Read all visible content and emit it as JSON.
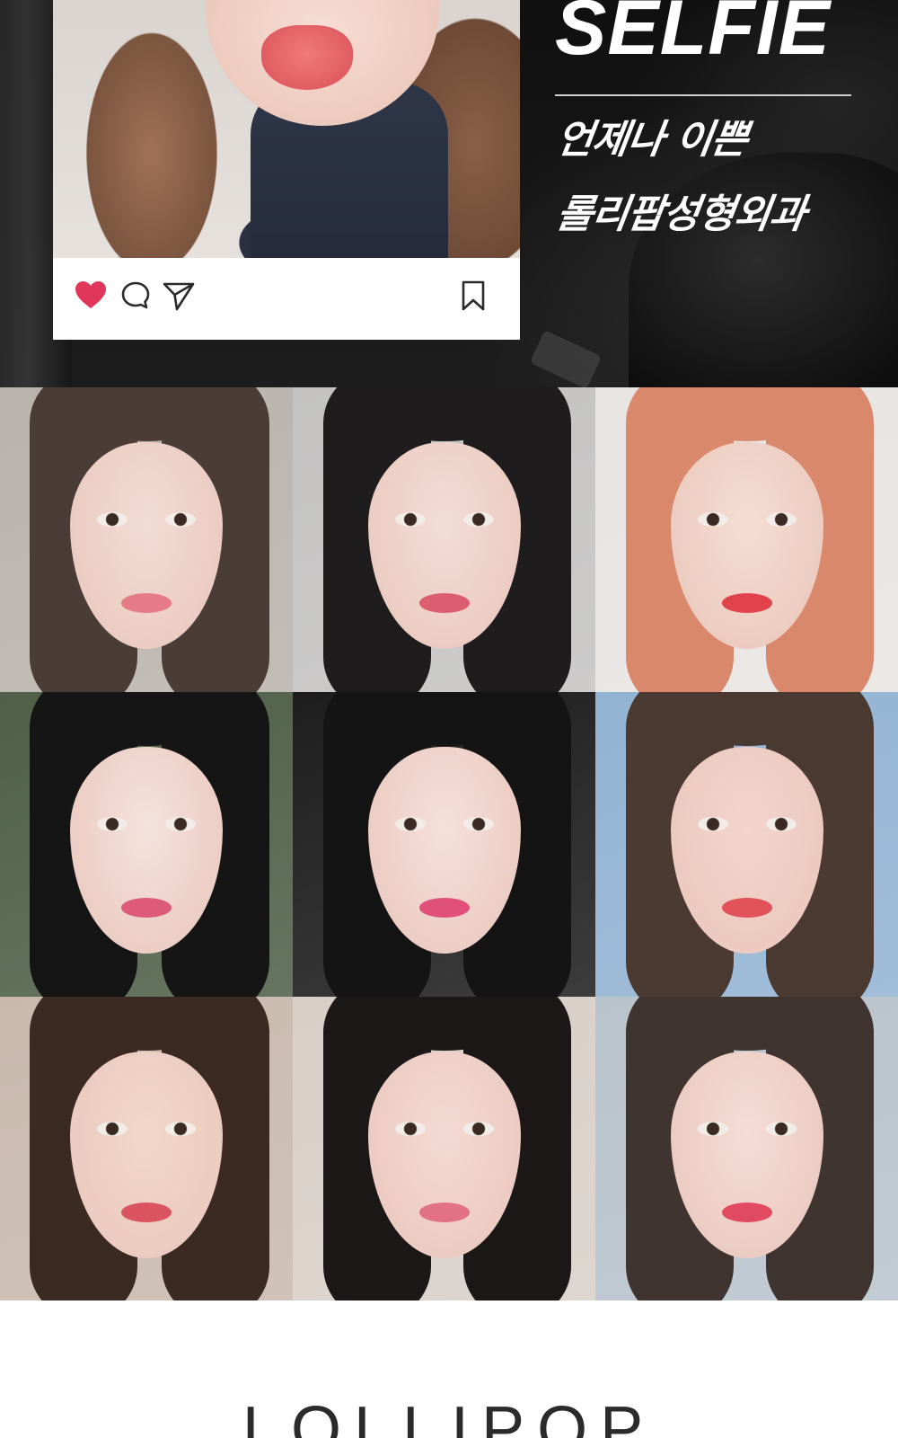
{
  "hero": {
    "title": "SELFIE",
    "tagline_line1": "언제나 이쁜",
    "tagline_line2": "롤리팝성형외과",
    "post_actions": {
      "like_icon": "heart-icon",
      "comment_icon": "comment-icon",
      "share_icon": "send-icon",
      "save_icon": "bookmark-icon"
    },
    "colors": {
      "like": "#e0365a",
      "lips": "#e86468",
      "background": "#141414",
      "text": "#ffffff"
    }
  },
  "grid": {
    "tiles": [
      {
        "label": "selfie-1",
        "bg": "#b9b3ad",
        "skin": "#f2dcd4",
        "hair": "#4a3d38",
        "lip": "#e47b86"
      },
      {
        "label": "selfie-2",
        "bg": "#c4c3c2",
        "skin": "#f3ddd6",
        "hair": "#1e1c1d",
        "lip": "#dd5d70"
      },
      {
        "label": "selfie-3",
        "bg": "#e8e4e2",
        "skin": "#f5ddd2",
        "hair": "#d9886c",
        "lip": "#e1434d"
      },
      {
        "label": "selfie-4",
        "bg": "#4f6047",
        "skin": "#f5e2dd",
        "hair": "#161516",
        "lip": "#dd5b78"
      },
      {
        "label": "selfie-5",
        "bg": "#1f1e1f",
        "skin": "#f6e0db",
        "hair": "#151415",
        "lip": "#e0507b"
      },
      {
        "label": "selfie-6",
        "bg": "#93b3d3",
        "skin": "#f3d4cc",
        "hair": "#4a3a32",
        "lip": "#e2525b"
      },
      {
        "label": "selfie-7",
        "bg": "#c9b9ad",
        "skin": "#f2d7cb",
        "hair": "#3a2a22",
        "lip": "#d95460"
      },
      {
        "label": "selfie-8",
        "bg": "#d8cfc8",
        "skin": "#f4dad3",
        "hair": "#1c1818",
        "lip": "#e27185"
      },
      {
        "label": "selfie-9",
        "bg": "#b9c3cc",
        "skin": "#f5ddd6",
        "hair": "#3f342f",
        "lip": "#e24a62"
      }
    ]
  },
  "footer": {
    "logo": "LOLLIPOP"
  }
}
